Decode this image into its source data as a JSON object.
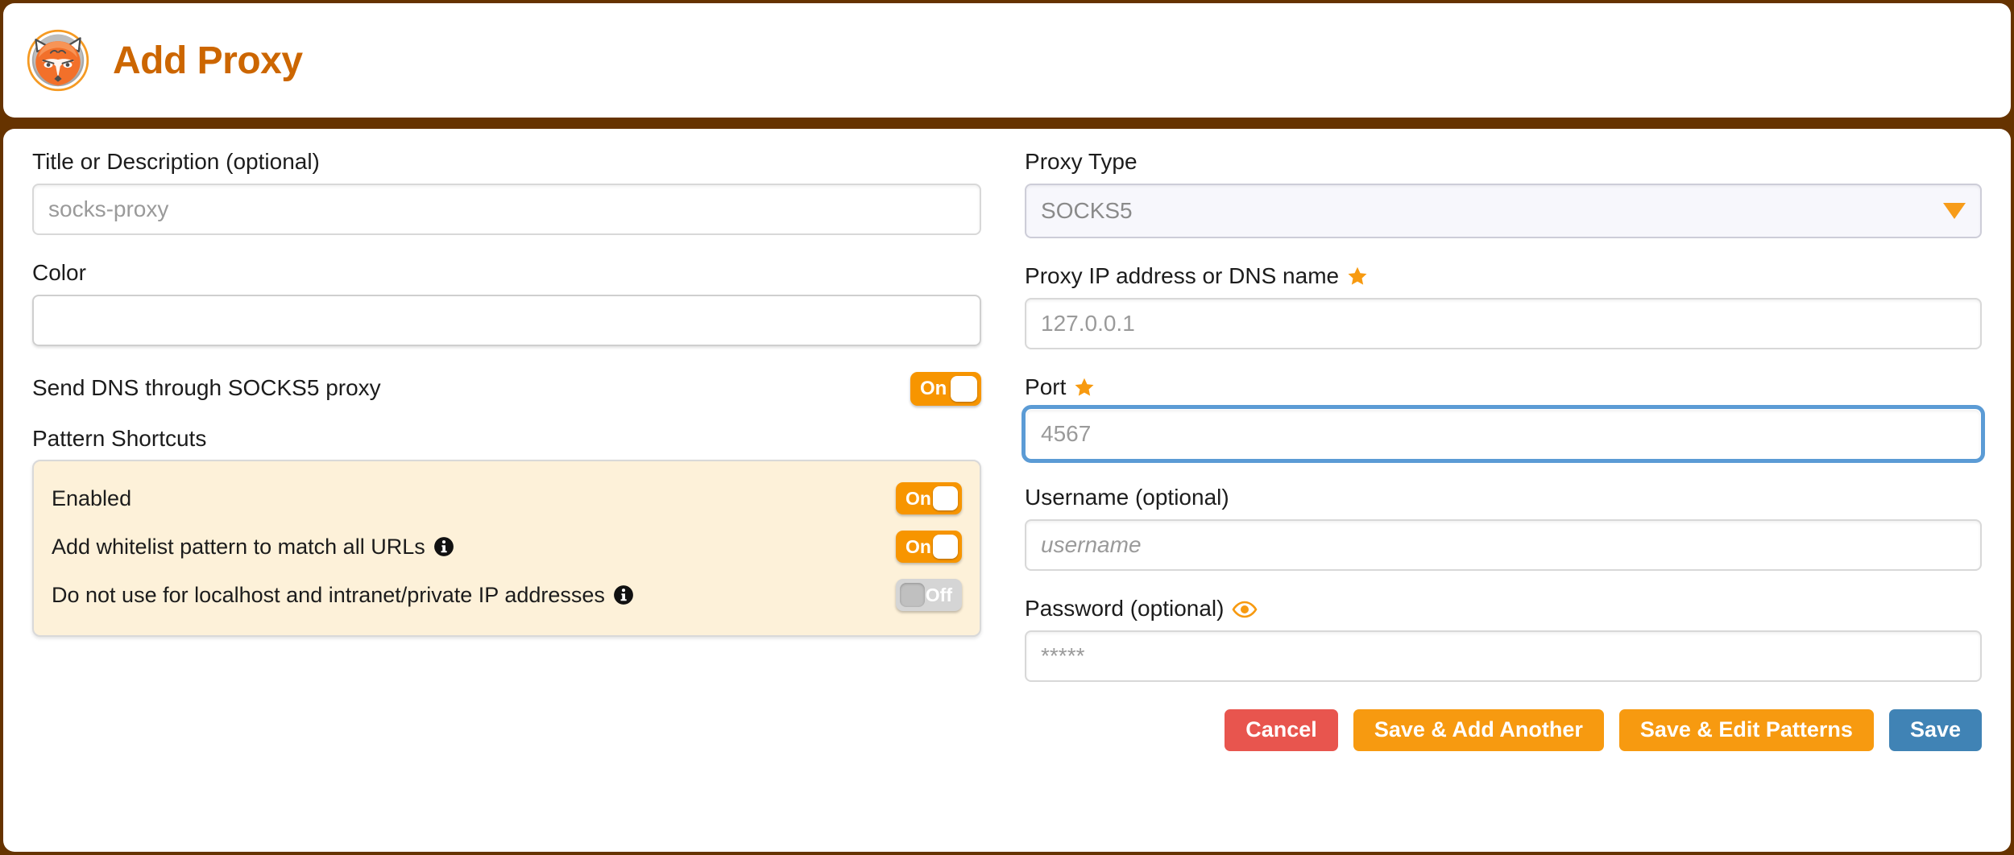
{
  "header": {
    "title": "Add Proxy",
    "logo_icon": "foxyproxy-fox-logo",
    "border_color": "#663300",
    "title_color": "#cc6600"
  },
  "left": {
    "title_field": {
      "label": "Title or Description (optional)",
      "placeholder": "socks-proxy",
      "value": ""
    },
    "color_field": {
      "label": "Color",
      "value": "#666666",
      "swatch_color": "#666666"
    },
    "dns_toggle": {
      "label": "Send DNS through SOCKS5 proxy",
      "state": "On"
    },
    "pattern_shortcuts": {
      "label": "Pattern Shortcuts",
      "rows": [
        {
          "text": "Enabled",
          "state": "On",
          "has_info": false
        },
        {
          "text": "Add whitelist pattern to match all URLs",
          "state": "On",
          "has_info": true
        },
        {
          "text": "Do not use for localhost and intranet/private IP addresses",
          "state": "Off",
          "has_info": true
        }
      ]
    }
  },
  "right": {
    "proxy_type": {
      "label": "Proxy Type",
      "selected": "SOCKS5",
      "options": [
        "SOCKS5"
      ]
    },
    "proxy_ip": {
      "label": "Proxy IP address or DNS name",
      "required": true,
      "placeholder": "127.0.0.1",
      "value": ""
    },
    "port": {
      "label": "Port",
      "required": true,
      "placeholder": "4567",
      "value": "",
      "focused": true
    },
    "username": {
      "label": "Username (optional)",
      "placeholder": "username",
      "value": ""
    },
    "password": {
      "label": "Password (optional)",
      "placeholder": "*****",
      "value": "",
      "has_eye": true
    },
    "buttons": [
      {
        "label": "Cancel",
        "color": "#e8554e"
      },
      {
        "label": "Save & Add Another",
        "color": "#f79a10"
      },
      {
        "label": "Save & Edit Patterns",
        "color": "#f79a10"
      },
      {
        "label": "Save",
        "color": "#4083b5"
      }
    ]
  }
}
